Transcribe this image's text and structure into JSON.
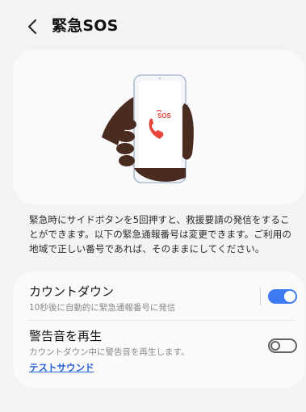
{
  "header": {
    "back_icon": "chevron-left-icon",
    "title": "緊急SOS"
  },
  "illustration": {
    "sos_label": "SOS",
    "phone_icon": "phone-handset-icon",
    "accent_color": "#e8453c"
  },
  "description": "緊急時にサイドボタンを5回押すと、救援要請の発信をすることができます。以下の緊急通報番号は変更できます。ご利用の地域で正しい番号であれば、そのままにしてください。",
  "settings": {
    "countdown": {
      "title": "カウントダウン",
      "subtitle": "10秒後に自動的に緊急通報番号に発信",
      "enabled": true
    },
    "alarm": {
      "title": "警告音を再生",
      "subtitle": "カウントダウン中に警告音を再生します。",
      "link": "テストサウンド",
      "enabled": false
    }
  },
  "colors": {
    "toggle_on": "#3e7bf2",
    "link": "#2860d8",
    "background": "#f3f3f3",
    "card": "#fafafa"
  }
}
